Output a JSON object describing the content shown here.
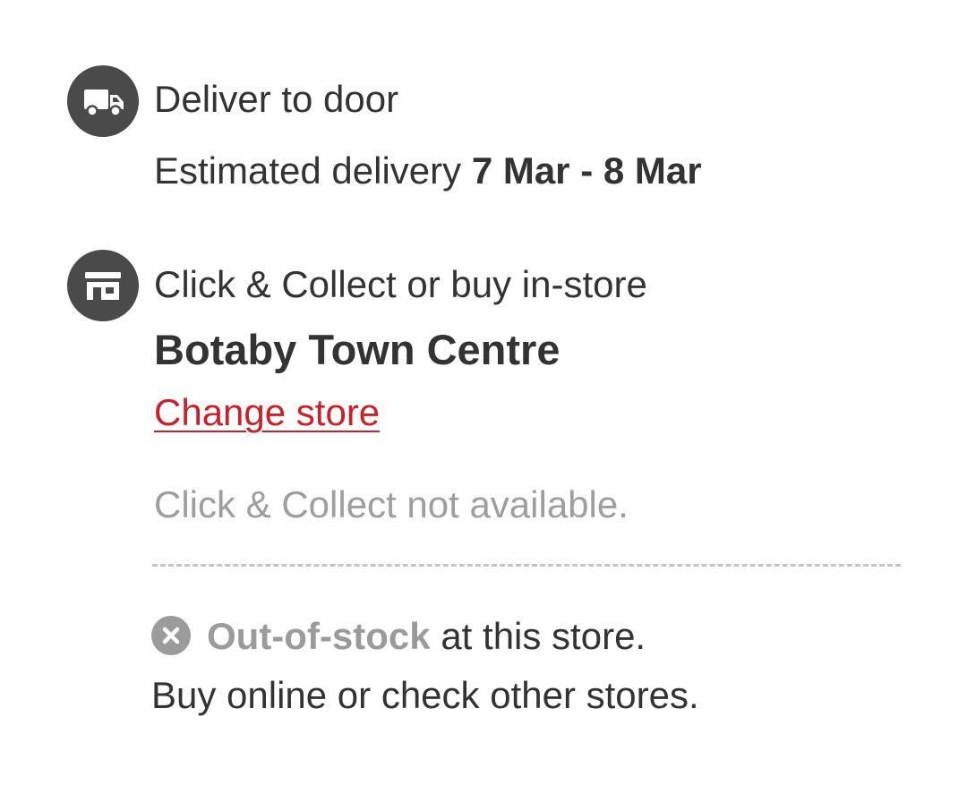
{
  "delivery": {
    "icon": "truck-icon",
    "title": "Deliver to door",
    "estimate_prefix": "Estimated delivery",
    "estimate_dates": "7 Mar - 8 Mar"
  },
  "click_collect": {
    "icon": "store-icon",
    "title": "Click & Collect or buy in-store",
    "store_name": "Botaby Town Centre",
    "change_store_label": "Change store",
    "availability": "Click & Collect not available."
  },
  "stock": {
    "icon": "close-circle-icon",
    "status": "Out-of-stock",
    "status_suffix": "at this store.",
    "advice": "Buy online or check other stores."
  },
  "colors": {
    "icon_bg": "#4a4a4a",
    "text": "#333333",
    "link_red": "#cc1f27",
    "muted": "#9e9e9e",
    "divider": "#c4c4c4"
  }
}
